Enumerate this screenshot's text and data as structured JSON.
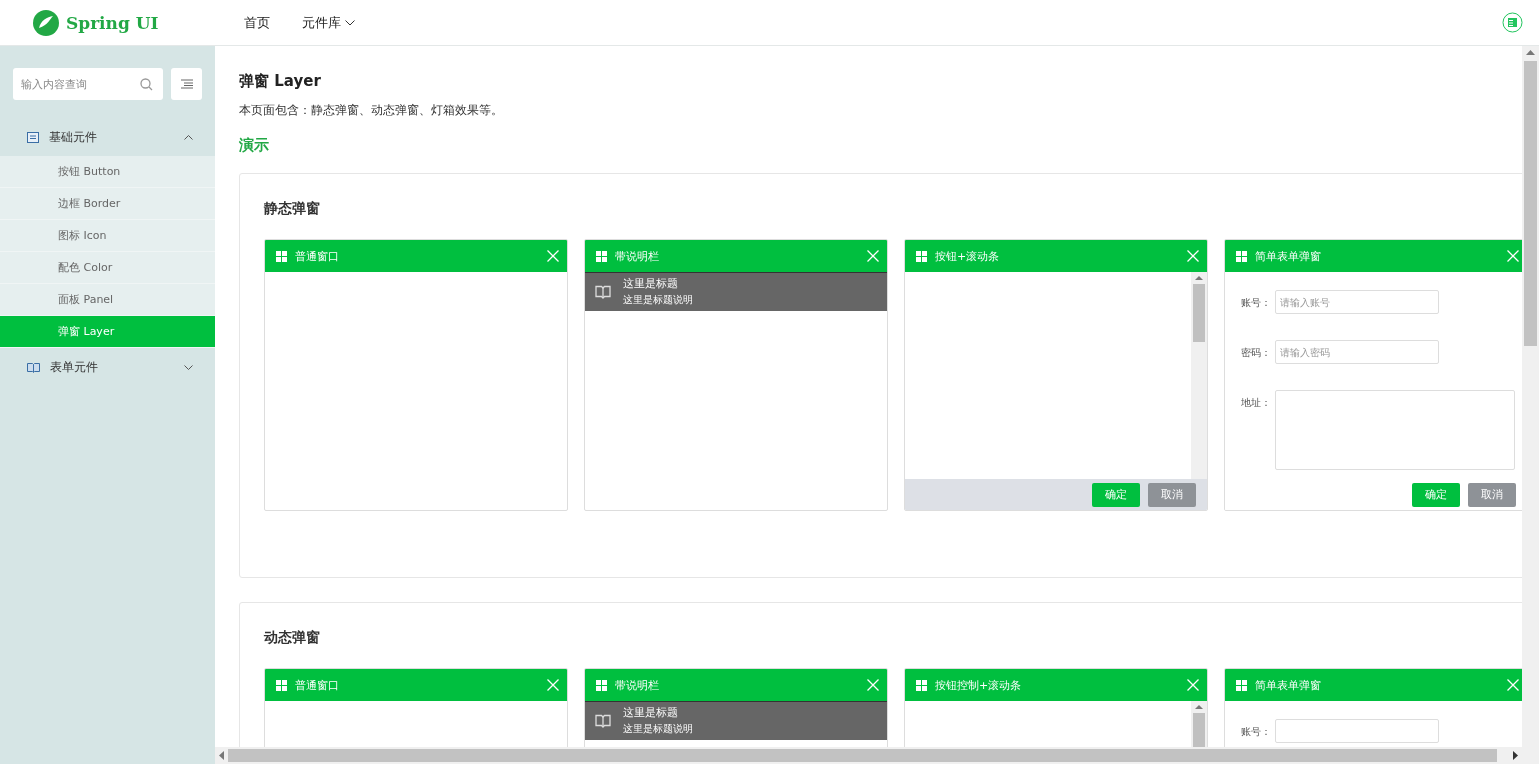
{
  "header": {
    "logo": "Spring UI",
    "nav": [
      {
        "label": "首页",
        "dropdown": false
      },
      {
        "label": "元件库",
        "dropdown": true
      }
    ]
  },
  "sidebar": {
    "search": {
      "placeholder": "输入内容查询"
    },
    "groups": [
      {
        "label": "基础元件",
        "expanded": true,
        "children": [
          {
            "label": "按钮 Button",
            "selected": false
          },
          {
            "label": "边框 Border",
            "selected": false
          },
          {
            "label": "图标 Icon",
            "selected": false
          },
          {
            "label": "配色 Color",
            "selected": false
          },
          {
            "label": "面板 Panel",
            "selected": false
          },
          {
            "label": "弹窗 Layer",
            "selected": true
          }
        ]
      },
      {
        "label": "表单元件",
        "expanded": false
      }
    ]
  },
  "page": {
    "title": "弹窗 Layer",
    "description": "本页面包含：静态弹窗、动态弹窗、灯箱效果等。",
    "section_heading": "演示"
  },
  "demos": [
    {
      "title": "静态弹窗",
      "layers": [
        {
          "kind": "plain",
          "title": "普通窗口"
        },
        {
          "kind": "caption",
          "title": "带说明栏",
          "caption_title": "这里是标题",
          "caption_text": "这里是标题说明"
        },
        {
          "kind": "scroll",
          "title": "按钮+滚动条",
          "buttons": [
            {
              "label": "确定",
              "kind": "primary"
            },
            {
              "label": "取消",
              "kind": "secondary"
            }
          ]
        },
        {
          "kind": "form",
          "title": "简单表单弹窗",
          "fields": [
            {
              "label": "账号：",
              "kind": "input",
              "placeholder": "请输入账号"
            },
            {
              "label": "密码：",
              "kind": "input",
              "placeholder": "请输入密码"
            },
            {
              "label": "地址：",
              "kind": "textarea"
            }
          ],
          "buttons": [
            {
              "label": "确定",
              "kind": "primary"
            },
            {
              "label": "取消",
              "kind": "secondary"
            }
          ]
        }
      ]
    },
    {
      "title": "动态弹窗",
      "layers": [
        {
          "kind": "plain",
          "title": "普通窗口"
        },
        {
          "kind": "caption",
          "title": "带说明栏",
          "caption_title": "这里是标题",
          "caption_text": "这里是标题说明"
        },
        {
          "kind": "scroll",
          "title": "按钮控制+滚动条"
        },
        {
          "kind": "form",
          "title": "简单表单弹窗",
          "fields": [
            {
              "label": "账号：",
              "kind": "input"
            }
          ]
        }
      ]
    }
  ]
}
